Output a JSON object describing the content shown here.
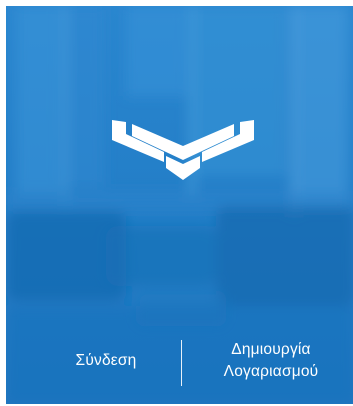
{
  "colors": {
    "background": "#1a74bf",
    "text": "#ffffff"
  },
  "branding": {
    "logo_icon": "brand-chevron-logo"
  },
  "actions": {
    "login_label": "Σύνδεση",
    "register_label": "Δημιουργία\nΛογαριασμού"
  }
}
